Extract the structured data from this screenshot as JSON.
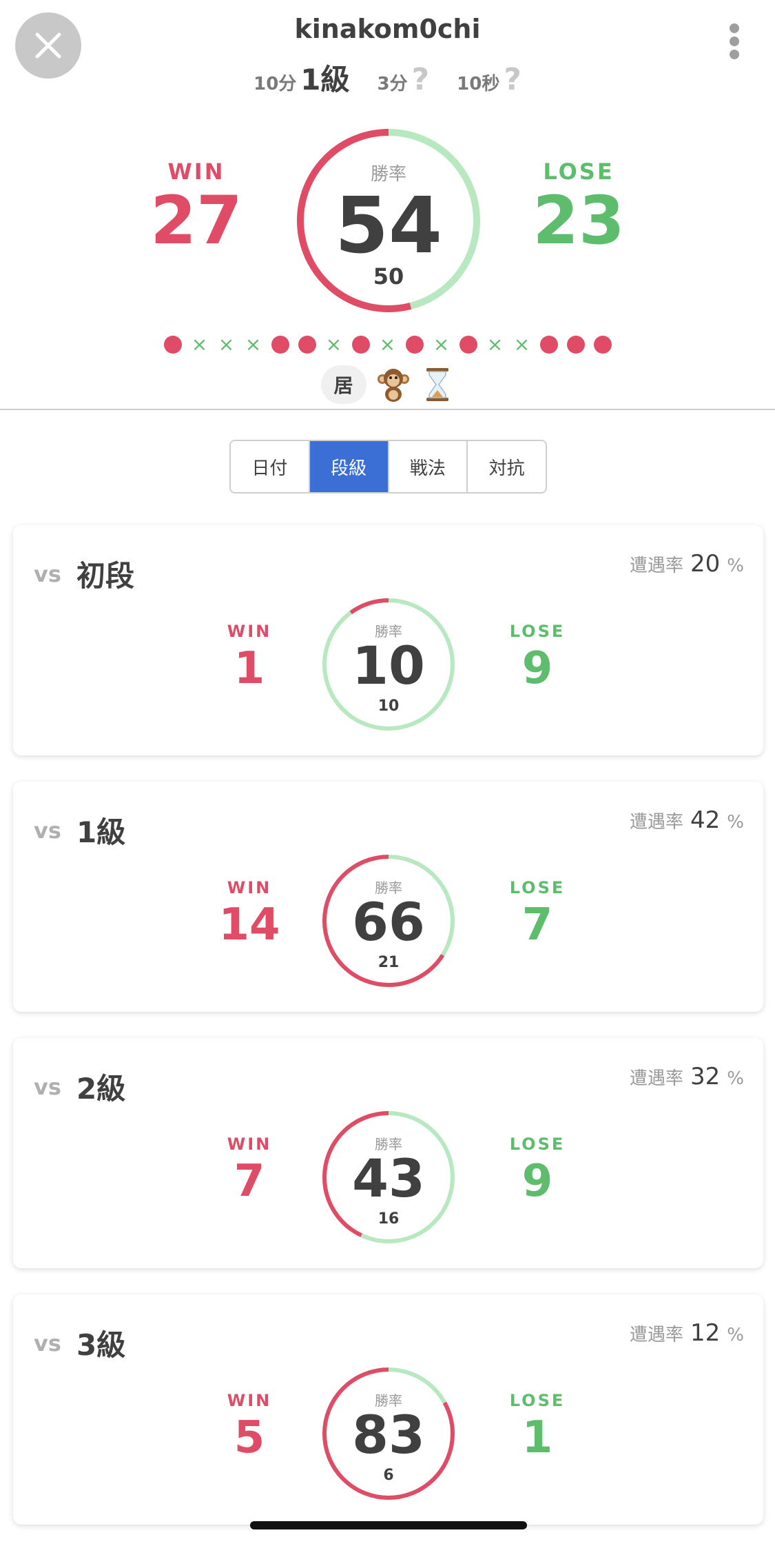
{
  "header": {
    "username": "kinakom0chi",
    "ranks": [
      {
        "label": "10分",
        "value": "1級",
        "known": true
      },
      {
        "label": "3分",
        "value": "?",
        "known": false
      },
      {
        "label": "10秒",
        "value": "?",
        "known": false
      }
    ],
    "close_icon": "close-icon",
    "more_icon": "vertical-dots-icon"
  },
  "summary": {
    "win_label": "WIN",
    "win_count": "27",
    "lose_label": "LOSE",
    "lose_count": "23",
    "rate_caption": "勝率",
    "win_rate": "54",
    "total": "50",
    "win_rate_value": 54
  },
  "history": [
    "win",
    "lose",
    "lose",
    "lose",
    "win",
    "win",
    "lose",
    "win",
    "lose",
    "win",
    "lose",
    "win",
    "lose",
    "lose",
    "win",
    "win",
    "win"
  ],
  "tags": {
    "kanji": "居",
    "icons": [
      "monkey-icon",
      "hourglass-icon"
    ]
  },
  "tabs": {
    "items": [
      "日付",
      "段級",
      "戦法",
      "対抗"
    ],
    "active": "段級"
  },
  "cards": [
    {
      "vs": "vs",
      "opponent": "初段",
      "rate_label": "遭遇率",
      "encounter": "20",
      "pct": "%",
      "win_label": "WIN",
      "win": "1",
      "lose_label": "LOSE",
      "lose": "9",
      "rate_caption": "勝率",
      "win_rate": "10",
      "total": "10",
      "win_rate_value": 10
    },
    {
      "vs": "vs",
      "opponent": "1級",
      "rate_label": "遭遇率",
      "encounter": "42",
      "pct": "%",
      "win_label": "WIN",
      "win": "14",
      "lose_label": "LOSE",
      "lose": "7",
      "rate_caption": "勝率",
      "win_rate": "66",
      "total": "21",
      "win_rate_value": 66
    },
    {
      "vs": "vs",
      "opponent": "2級",
      "rate_label": "遭遇率",
      "encounter": "32",
      "pct": "%",
      "win_label": "WIN",
      "win": "7",
      "lose_label": "LOSE",
      "lose": "9",
      "rate_caption": "勝率",
      "win_rate": "43",
      "total": "16",
      "win_rate_value": 43
    },
    {
      "vs": "vs",
      "opponent": "3級",
      "rate_label": "遭遇率",
      "encounter": "12",
      "pct": "%",
      "win_label": "WIN",
      "win": "5",
      "lose_label": "LOSE",
      "lose": "1",
      "rate_caption": "勝率",
      "win_rate": "83",
      "total": "6",
      "win_rate_value": 83
    }
  ],
  "colors": {
    "win": "#e04b65",
    "lose_ring": "#b7e8bf",
    "lose_text": "#5dbd6c",
    "tab_active": "#3c6fd6"
  }
}
